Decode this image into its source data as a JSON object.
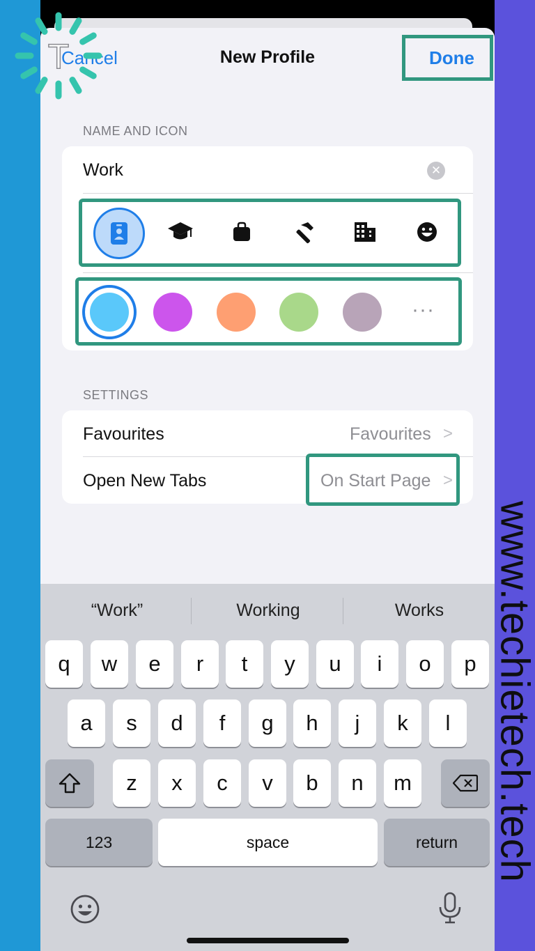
{
  "nav": {
    "cancel": "Cancel",
    "title": "New Profile",
    "done": "Done"
  },
  "name_section": {
    "header": "NAME AND ICON",
    "name_value": "Work",
    "icons": [
      "id-badge-icon",
      "graduation-cap-icon",
      "briefcase-icon",
      "hammer-icon",
      "building-icon",
      "smiley-icon"
    ],
    "selected_icon": "id-badge-icon",
    "colors": [
      "#5ac8fa",
      "#cc55ec",
      "#fe9f72",
      "#a9d88a",
      "#b8a4b8"
    ],
    "selected_color": "#5ac8fa",
    "more_colors": "···"
  },
  "settings": {
    "header": "SETTINGS",
    "rows": [
      {
        "label": "Favourites",
        "value": "Favourites"
      },
      {
        "label": "Open New Tabs",
        "value": "On Start Page"
      }
    ]
  },
  "keyboard": {
    "suggestions": [
      "“Work”",
      "Working",
      "Works"
    ],
    "row1": [
      "q",
      "w",
      "e",
      "r",
      "t",
      "y",
      "u",
      "i",
      "o",
      "p"
    ],
    "row2": [
      "a",
      "s",
      "d",
      "f",
      "g",
      "h",
      "j",
      "k",
      "l"
    ],
    "row3": [
      "z",
      "x",
      "c",
      "v",
      "b",
      "n",
      "m"
    ],
    "numbers": "123",
    "space": "space",
    "return": "return"
  },
  "watermark": {
    "url": "www.techietech.tech",
    "logo_letter": "T"
  },
  "colors": {
    "accent": "#1f7ee8",
    "highlight": "#31977f",
    "left_bg": "#1f98d6",
    "right_bg": "#5b52dc"
  }
}
